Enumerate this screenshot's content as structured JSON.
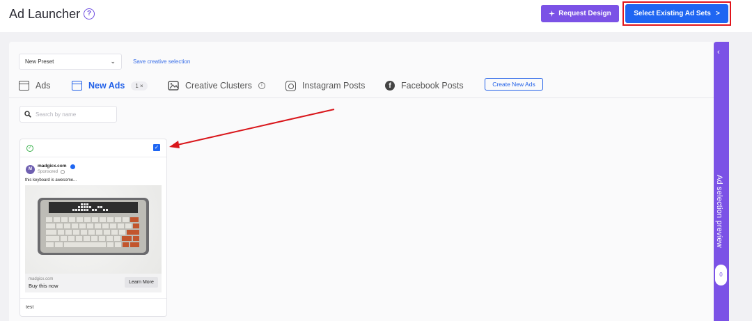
{
  "header": {
    "title": "Ad Launcher",
    "request_design_label": "Request Design",
    "select_adsets_label": "Select Existing Ad Sets",
    "select_adsets_chevron": ">"
  },
  "toolbar": {
    "preset_value": "New Preset",
    "save_link": "Save creative selection"
  },
  "tabs": [
    {
      "label": "Ads"
    },
    {
      "label": "New Ads",
      "badge": "1 ×"
    },
    {
      "label": "Creative Clusters"
    },
    {
      "label": "Instagram Posts"
    },
    {
      "label": "Facebook Posts"
    }
  ],
  "create_new_ads_label": "Create New Ads",
  "search": {
    "placeholder": "Search by name"
  },
  "ad_card": {
    "avatar_letter": "M",
    "page_name": "madgicx.com",
    "sponsored": "Sponsored",
    "primary_text": "this keyboard is awesome...",
    "domain": "madgicx.com",
    "headline": "Buy this now",
    "cta": "Learn More",
    "name": "test",
    "selected": true
  },
  "side_panel": {
    "label": "Ad selection preview",
    "count": "0"
  },
  "colors": {
    "accent_purple": "#7b52e6",
    "primary_blue": "#1f66f2",
    "highlight_red": "#e0141b"
  }
}
